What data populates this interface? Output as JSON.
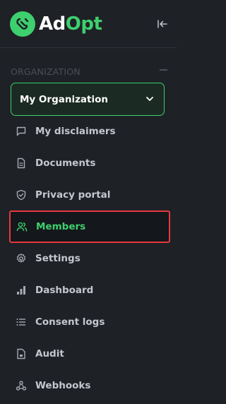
{
  "brand": {
    "name_part1": "Ad",
    "name_part2": "Opt",
    "accent_color": "#3ecf6e"
  },
  "section": {
    "title": "ORGANIZATION"
  },
  "org_select": {
    "value": "My Organization"
  },
  "nav": {
    "items": [
      {
        "label": "My disclaimers",
        "icon": "message-square-icon"
      },
      {
        "label": "Documents",
        "icon": "document-icon"
      },
      {
        "label": "Privacy portal",
        "icon": "shield-check-icon"
      },
      {
        "label": "Members",
        "icon": "users-icon",
        "active": true
      },
      {
        "label": "Settings",
        "icon": "gear-icon"
      },
      {
        "label": "Dashboard",
        "icon": "bar-chart-icon"
      },
      {
        "label": "Consent logs",
        "icon": "list-icon"
      },
      {
        "label": "Audit",
        "icon": "audit-file-icon"
      },
      {
        "label": "Webhooks",
        "icon": "webhooks-icon"
      }
    ]
  },
  "colors": {
    "background": "#1e2126",
    "active_highlight": "#e5393e",
    "active_text": "#3ecf6e"
  }
}
